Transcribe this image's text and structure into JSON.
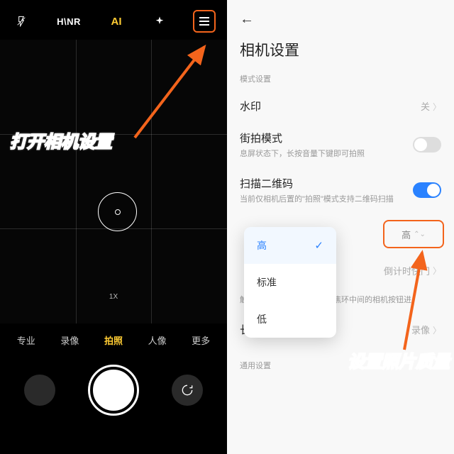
{
  "left": {
    "topbar": {
      "hnr": "H\\NR",
      "ai": "AI"
    },
    "zoom": "1X",
    "modes": [
      "专业",
      "录像",
      "拍照",
      "人像",
      "更多"
    ],
    "active_mode_index": 2
  },
  "right": {
    "title": "相机设置",
    "section_mode": "模式设置",
    "watermark": {
      "label": "水印",
      "value": "关"
    },
    "street": {
      "label": "街拍模式",
      "sub": "息屏状态下，长按音量下键即可拍照",
      "on": false
    },
    "qrcode": {
      "label": "扫描二维码",
      "sub": "当前仅相机后置的\"拍照\"模式支持二维码扫描",
      "on": true
    },
    "quality_value": "高",
    "countdown": {
      "value": "倒计时快门"
    },
    "focus_help": "触摸对焦成功之后，点击对焦环中间的相机按钮进",
    "longpress": {
      "label": "长按快门功能",
      "value": "录像"
    },
    "section_general": "通用设置"
  },
  "popup": {
    "options": [
      "高",
      "标准",
      "低"
    ],
    "selected_index": 0
  },
  "annotations": {
    "left": "打开相机设置",
    "right": "设置照片质量"
  }
}
